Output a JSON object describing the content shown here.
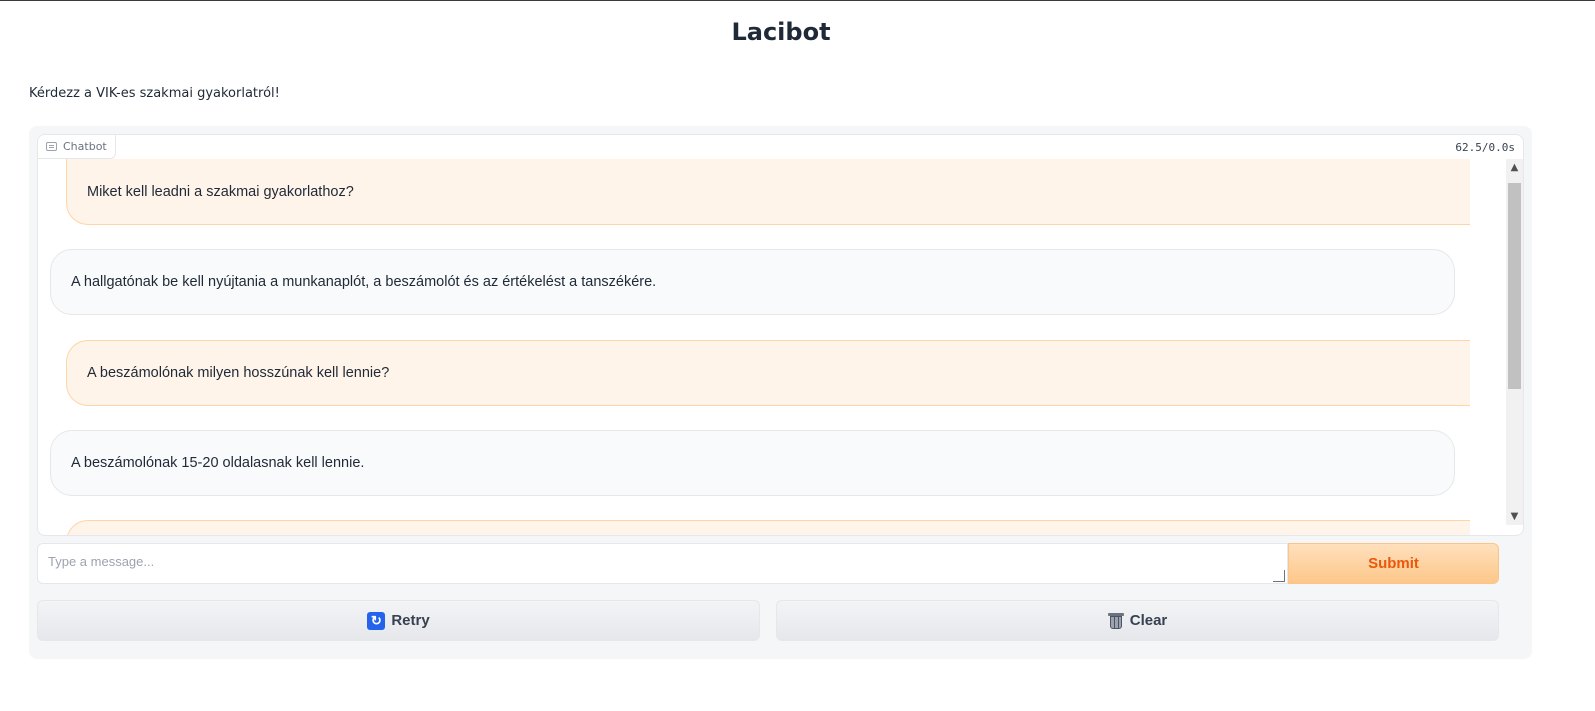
{
  "app": {
    "title": "Lacibot",
    "description": "Kérdezz a VIK-es szakmai gyakorlatról!"
  },
  "chatbot": {
    "label": "Chatbot",
    "timer": "62.5/0.0s",
    "messages": [
      {
        "role": "user",
        "text": "Miket kell leadni a szakmai gyakorlathoz?"
      },
      {
        "role": "bot",
        "text": "A hallgatónak be kell nyújtania a munkanaplót, a beszámolót és az értékelést a tanszékére."
      },
      {
        "role": "user",
        "text": "A beszámolónak milyen hosszúnak kell lennie?"
      },
      {
        "role": "bot",
        "text": "A beszámolónak 15-20 oldalasnak kell lennie."
      },
      {
        "role": "user",
        "text": ""
      }
    ]
  },
  "input": {
    "placeholder": "Type a message...",
    "value": "",
    "submit_label": "Submit"
  },
  "buttons": {
    "retry_label": "Retry",
    "retry_icon": "retry-icon",
    "clear_label": "Clear",
    "clear_icon": "trash-icon"
  },
  "colors": {
    "user_bubble": "#fff4ea",
    "user_border": "#fdd5a8",
    "bot_bubble": "#f9fafb",
    "submit_text": "#ea580c"
  }
}
